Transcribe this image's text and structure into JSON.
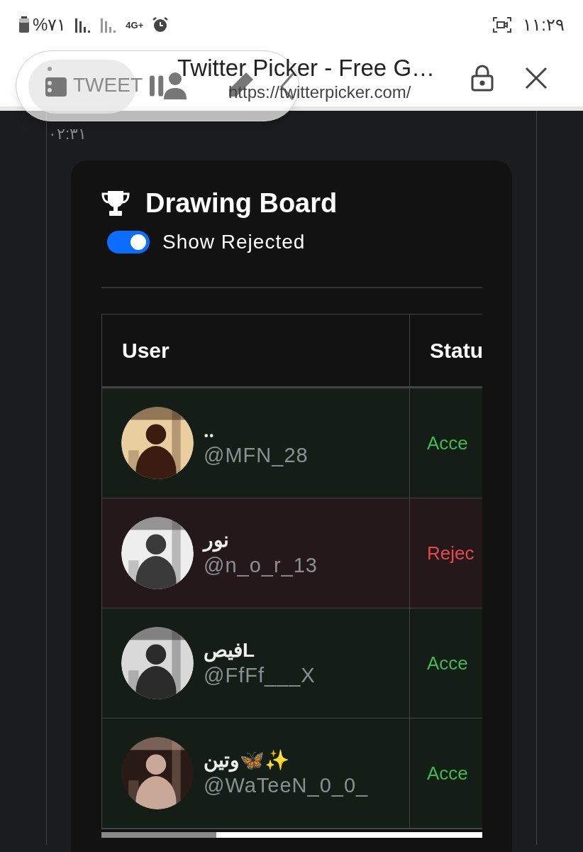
{
  "status_bar": {
    "battery": "%٧١",
    "network": "4G+",
    "time": "١١:٢٩"
  },
  "browser": {
    "title": "Twitter Picker - Free G…",
    "url": "https://twitterpicker.com/"
  },
  "floating_toolbar": {
    "label": "TWEET"
  },
  "page": {
    "timestamp": "٠٢:٣١"
  },
  "card": {
    "title": "Drawing Board",
    "toggle": {
      "label": "Show Rejected",
      "on": true
    },
    "table": {
      "columns": [
        "User",
        "Statu"
      ],
      "rows": [
        {
          "name": "‥",
          "handle": "@MFN_28",
          "status": "Acce",
          "kind": "accepted"
        },
        {
          "name": "نور",
          "handle": "@n_o_r_13",
          "status": "Rejec",
          "kind": "rejected"
        },
        {
          "name": "فيصL",
          "handle": "@FfFf___X",
          "status": "Acce",
          "kind": "accepted"
        },
        {
          "name": "وتين🦋✨",
          "handle": "@WaTeeN_0_0_",
          "status": "Acce",
          "kind": "accepted"
        }
      ]
    }
  }
}
